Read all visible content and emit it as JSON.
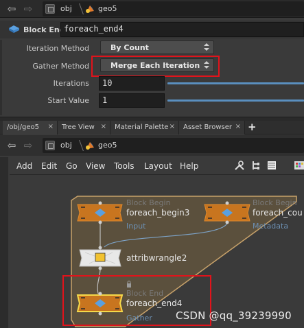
{
  "top_path": {
    "obj": "obj",
    "geo": "geo5"
  },
  "param_header": {
    "type_label": "Block End",
    "node_name": "foreach_end4"
  },
  "params": {
    "iteration_method": {
      "label": "Iteration Method",
      "value": "By Count"
    },
    "gather_method": {
      "label": "Gather Method",
      "value": "Merge Each Iteration"
    },
    "iterations": {
      "label": "Iterations",
      "value": "10"
    },
    "start_value": {
      "label": "Start Value",
      "value": "1"
    }
  },
  "tabs": [
    {
      "label": "/obj/geo5",
      "close": "×"
    },
    {
      "label": "Tree View",
      "close": "×"
    },
    {
      "label": "Material Palette",
      "close": "×"
    },
    {
      "label": "Asset Browser",
      "close": "×"
    }
  ],
  "add_tab": "+",
  "network_path": {
    "obj": "obj",
    "geo": "geo5"
  },
  "menubar": [
    "Add",
    "Edit",
    "Go",
    "View",
    "Tools",
    "Layout",
    "Help"
  ],
  "nodes": {
    "begin1": {
      "type": "Block Begin",
      "name": "foreach_begin3",
      "sub": "Input"
    },
    "begin2": {
      "type": "Block Begin",
      "name": "foreach_cou",
      "sub": "Metadata"
    },
    "wrangle": {
      "name": "attribwrangle2"
    },
    "end": {
      "type": "Block End",
      "name": "foreach_end4",
      "sub": "Gather"
    }
  },
  "watermark": "CSDN @qq_39239990",
  "colors": {
    "highlight": "#e1131b",
    "node_orange": "#c8751f",
    "block_fill": "#6a5a3e",
    "block_border": "#c8a26a",
    "sub_link": "#6c8fb2"
  }
}
